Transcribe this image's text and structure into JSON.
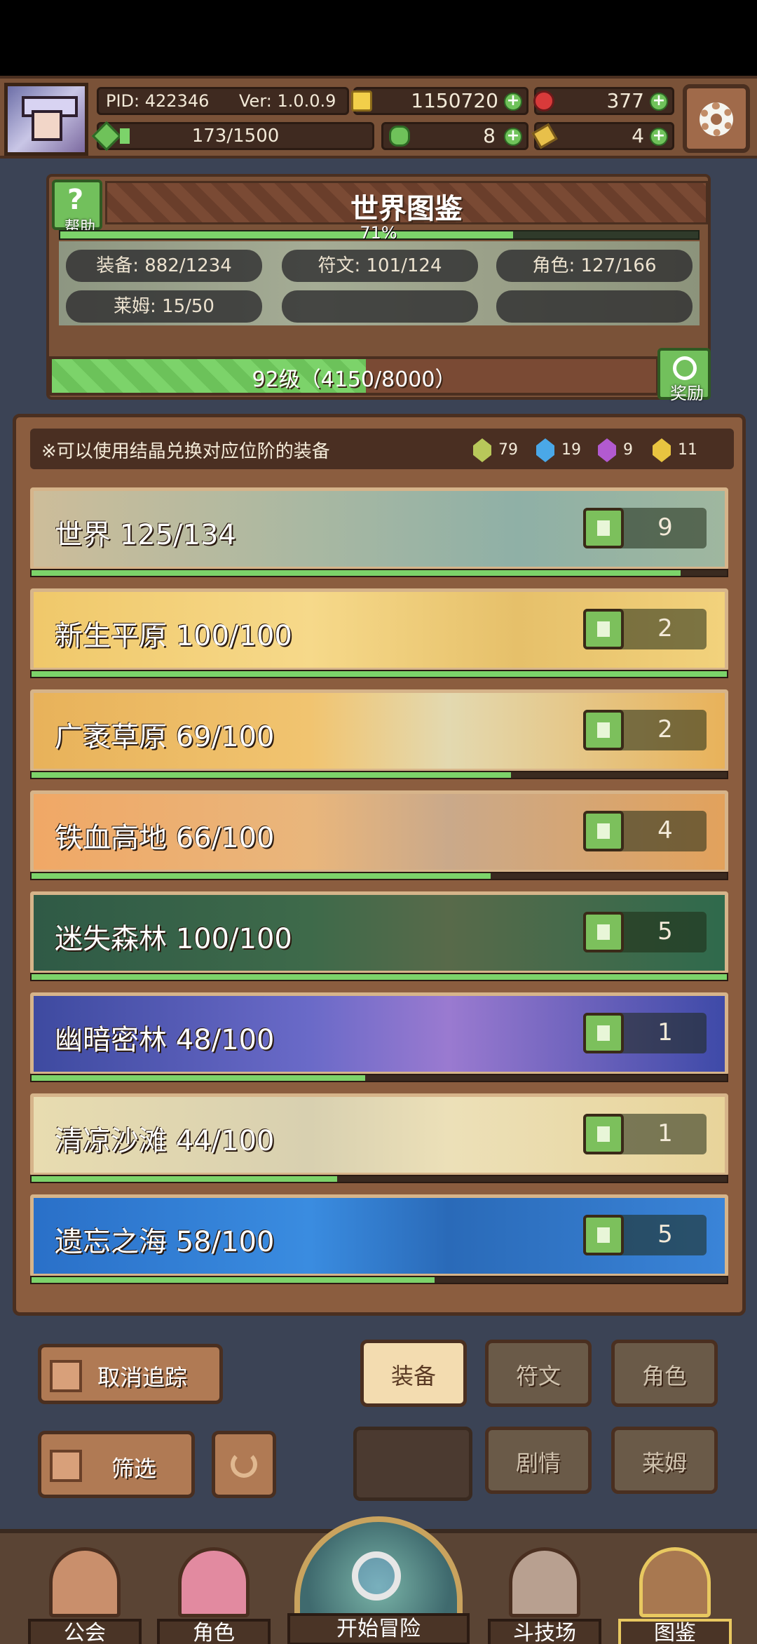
{
  "topbar": {
    "pid": "PID: 422346",
    "version": "Ver: 1.0.0.9",
    "gold": "1150720",
    "gems": "377",
    "exp": "173/1500",
    "clovers": "8",
    "keys": "4"
  },
  "header": {
    "help_label": "帮助",
    "title": "世界图鉴",
    "percent": "71%",
    "percent_value": 0.71,
    "stats": [
      "装备: 882/1234",
      "符文: 101/124",
      "角色: 127/166",
      "莱姆: 15/50"
    ],
    "level_text": "92级（4150/8000）",
    "level_progress": 0.52,
    "reward_label": "奖励"
  },
  "tip": {
    "text": "※可以使用结晶兑换对应位阶的装备",
    "crystals": [
      {
        "count": "79",
        "color": "#b8c85a"
      },
      {
        "count": "19",
        "color": "#4aa8e8"
      },
      {
        "count": "9",
        "color": "#b25ad0"
      },
      {
        "count": "11",
        "color": "#e8c440"
      }
    ]
  },
  "regions": [
    {
      "name": "世界  125/134",
      "likes": "9",
      "progress": 0.933,
      "bg": "linear-gradient(90deg,#cdbd9a,#a9b8a2 40%,#8fb0a6 70%,#9fb79f)"
    },
    {
      "name": "新生平原  100/100",
      "likes": "2",
      "progress": 1.0,
      "bg": "linear-gradient(90deg,#f0c86a,#f6d98a 40%,#e6c06a 70%,#f2d27c)"
    },
    {
      "name": "广袤草原  69/100",
      "likes": "2",
      "progress": 0.69,
      "bg": "linear-gradient(90deg,#e8b25a,#f1c470 40%,#e3d9b0 60%,#e8b25a)"
    },
    {
      "name": "铁血高地  66/100",
      "likes": "4",
      "progress": 0.66,
      "bg": "linear-gradient(90deg,#f0a866,#e9b67c 40%,#caa98a 60%,#e2a25c)"
    },
    {
      "name": "迷失森林  100/100",
      "likes": "5",
      "progress": 1.0,
      "bg": "linear-gradient(90deg,#2f5a46,#3e6a4a 40%,#586a4a 60%,#2f6a4c)"
    },
    {
      "name": "幽暗密林  48/100",
      "likes": "1",
      "progress": 0.48,
      "bg": "linear-gradient(90deg,#3e4aa0,#6a6ac8 40%,#9a7ad0 60%,#3e4aa8)"
    },
    {
      "name": "清凉沙滩  44/100",
      "likes": "1",
      "progress": 0.44,
      "bg": "linear-gradient(90deg,#e8dcb0,#d8d0b0 40%,#ece0b8 60%,#e8d49a)"
    },
    {
      "name": "遗忘之海  58/100",
      "likes": "5",
      "progress": 0.58,
      "bg": "linear-gradient(90deg,#2a70c8,#3a8ce0 40%,#2a6ab8 60%,#3a84d8)"
    }
  ],
  "controls": {
    "untrack": "取消追踪",
    "filter": "筛选",
    "tabs": [
      "装备",
      "符文",
      "角色",
      "剧情",
      "莱姆"
    ]
  },
  "nav": {
    "items": [
      "公会",
      "角色",
      "开始冒险",
      "斗技场",
      "图鉴"
    ]
  },
  "colors": {
    "accent_green": "#7cd36a",
    "panel_brown": "#7a5238"
  }
}
